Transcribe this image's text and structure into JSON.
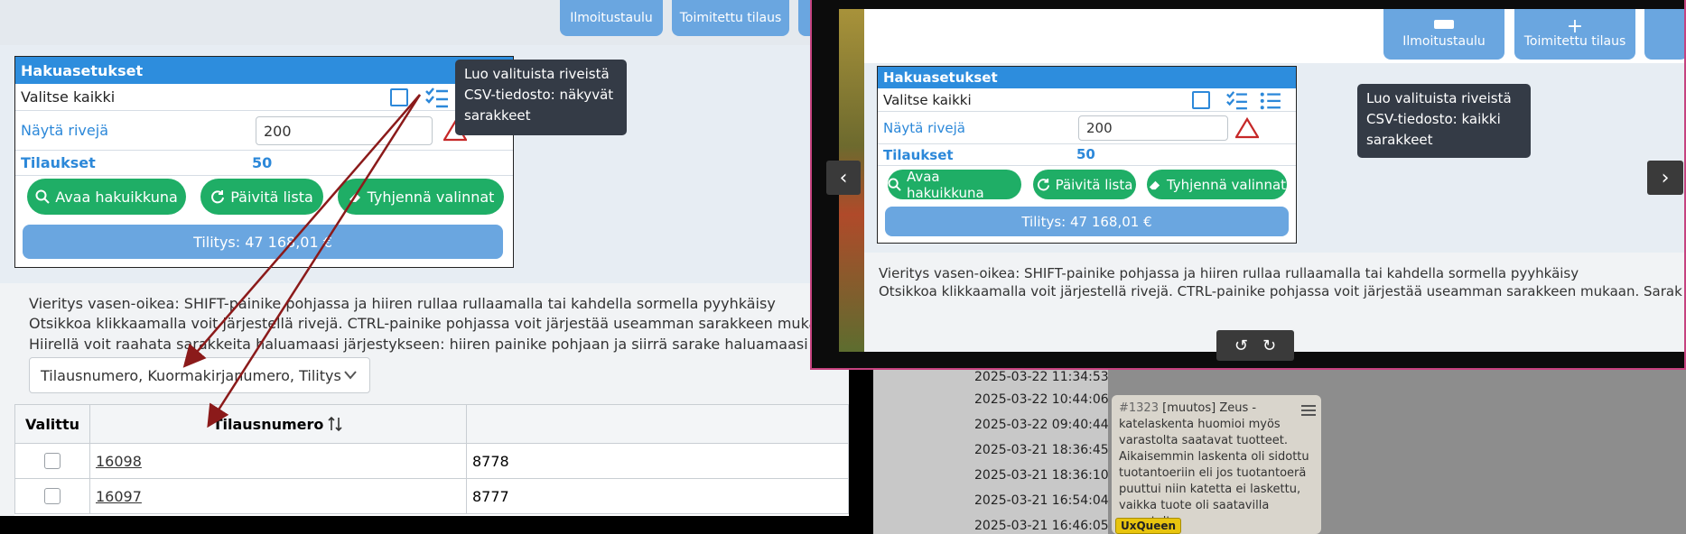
{
  "top_buttons": {
    "notice_board": "Ilmoitustaulu",
    "delivered_order": "Toimitettu tilaus"
  },
  "panel": {
    "title": "Hakuasetukset",
    "select_all": "Valitse kaikki",
    "show_rows_label": "Näytä rivejä",
    "show_rows_value": "200",
    "orders_label": "Tilaukset",
    "orders_value": "50",
    "open_search": "Avaa hakuikkuna",
    "refresh_list": "Päivitä lista",
    "clear_selection": "Tyhjennä valinnat",
    "settlement": "Tilitys: 47 168,01 €"
  },
  "tooltip_left": "Luo valituista riveistä CSV-tiedosto: näkyvät sarakkeet",
  "tooltip_right": "Luo valituista riveistä CSV-tiedosto: kaikki sarakkeet",
  "info": {
    "line1": "Vieritys vasen-oikea: SHIFT-painike pohjassa ja hiiren rullaa rullaamalla tai kahdella sormella pyyhkäisy",
    "line2": "Otsikkoa klikkaamalla voit järjestellä rivejä. CTRL-painike pohjassa voit järjestää useamman sarakkeen mukaan. Sarak",
    "line3": "Hiirellä voit raahata sarakkeita haluamaasi järjestykseen: hiiren painike pohjaan ja siirrä sarake haluamaasi kohtaan",
    "line2_right": "Otsikkoa klikkaamalla voit järjestellä rivejä. CTRL-painike pohjassa voit järjestää useamman sarakkeen mukaan. Sarak"
  },
  "sort_select": "Tilausnumero, Kuormakirjanumero, Tilitys",
  "table": {
    "headers": [
      "Valittu",
      "Tilausnumero"
    ],
    "rows": [
      {
        "order": "16098",
        "waybill": "8778"
      },
      {
        "order": "16097",
        "waybill": "8777"
      }
    ]
  },
  "timestamps": [
    "2025-03-22 11:34:53",
    "2025-03-22 10:44:06",
    "2025-03-22 09:40:44",
    "2025-03-21 18:36:45",
    "2025-03-21 18:36:10",
    "2025-03-21 16:54:04",
    "2025-03-21 16:46:05"
  ],
  "note": {
    "id": "#1323",
    "text": "[muutos] Zeus - katelaskenta huomioi myös varastolta saatavat tuotteet. Aikaisemmin laskenta oli sidottu tuotantoeriin eli jos tuotantoerä puuttui niin katetta ei laskettu, vaikka tuote oli saatavilla varastolta.",
    "author": "UxQueen"
  },
  "colors": {
    "primary_blue": "#2d8ddd",
    "green": "#1fae66",
    "arrow": "#8b1a1a"
  }
}
